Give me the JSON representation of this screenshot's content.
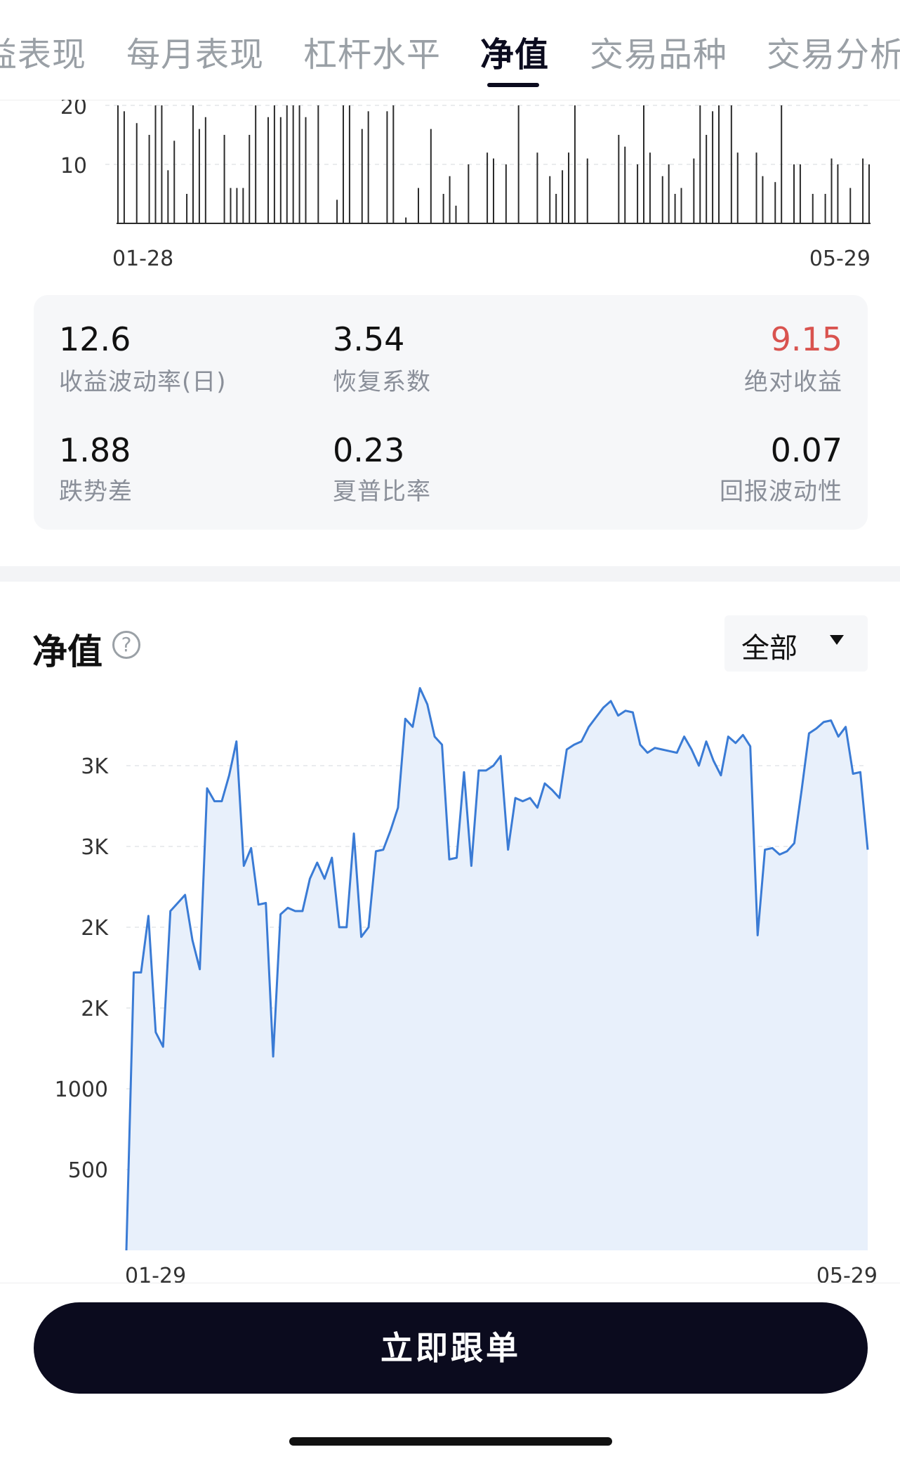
{
  "tabs": [
    {
      "label": "益表现",
      "active": false
    },
    {
      "label": "每月表现",
      "active": false
    },
    {
      "label": "杠杆水平",
      "active": false
    },
    {
      "label": "净值",
      "active": true
    },
    {
      "label": "交易品种",
      "active": false
    },
    {
      "label": "交易分析",
      "active": false
    }
  ],
  "stats": [
    {
      "value": "12.6",
      "label": "收益波动率(日)"
    },
    {
      "value": "3.54",
      "label": "恢复系数"
    },
    {
      "value": "9.15",
      "label": "绝对收益",
      "color": "#d9534f"
    },
    {
      "value": "1.88",
      "label": "跌势差"
    },
    {
      "value": "0.23",
      "label": "夏普比率"
    },
    {
      "value": "0.07",
      "label": "回报波动性"
    }
  ],
  "section": {
    "title": "净值",
    "help_icon": "question-circle-icon"
  },
  "range_select": {
    "value": "全部",
    "icon": "caret-down-icon"
  },
  "follow_button": {
    "label": "立即跟单"
  },
  "colors": {
    "accent": "#3a7bd5",
    "area": "#e8f0fb",
    "dark": "#0b0b1e",
    "positive_red": "#d9534f"
  },
  "chart_data": [
    {
      "type": "bar",
      "ytick_labels": [
        "20",
        "10"
      ],
      "y_ticks": [
        20,
        10
      ],
      "ylim": [
        0,
        20
      ],
      "xtick_labels": [
        "01-28",
        "05-29"
      ],
      "values": [
        20,
        19,
        0,
        17,
        0,
        15,
        20,
        20,
        9,
        14,
        0,
        5,
        20,
        16,
        18,
        0,
        0,
        15,
        6,
        6,
        6,
        15,
        20,
        0,
        18,
        20,
        18,
        20,
        20,
        20,
        18,
        0,
        20,
        0,
        0,
        4,
        20,
        20,
        0,
        16,
        19,
        0,
        0,
        19,
        20,
        0,
        1,
        0,
        6,
        0,
        16,
        0,
        5,
        8,
        3,
        0,
        10,
        0,
        0,
        12,
        11,
        0,
        10,
        0,
        20,
        0,
        0,
        12,
        0,
        8,
        5,
        9,
        12,
        20,
        0,
        11,
        0,
        0,
        0,
        0,
        15,
        13,
        0,
        10,
        20,
        12,
        0,
        8,
        10,
        5,
        6,
        0,
        11,
        20,
        15,
        19,
        20,
        0,
        20,
        12,
        0,
        0,
        12,
        8,
        0,
        7,
        20,
        0,
        10,
        10,
        0,
        5,
        0,
        5,
        11,
        10,
        0,
        6,
        0,
        11,
        10
      ],
      "grid": true
    },
    {
      "type": "area",
      "ytick_labels": [
        "3K",
        "3K",
        "2K",
        "2K",
        "1000",
        "500"
      ],
      "y_ticks": [
        3000,
        2500,
        2000,
        1500,
        1000,
        500
      ],
      "ylim": [
        0,
        3500
      ],
      "xtick_labels": [
        "01-29",
        "05-29"
      ],
      "values": [
        0,
        1720,
        1720,
        2070,
        1350,
        1260,
        2100,
        2150,
        2200,
        1920,
        1740,
        2860,
        2780,
        2780,
        2940,
        3150,
        2380,
        2490,
        2140,
        2150,
        1200,
        2080,
        2120,
        2100,
        2100,
        2300,
        2400,
        2300,
        2430,
        2000,
        2000,
        2580,
        1940,
        2000,
        2470,
        2480,
        2600,
        2740,
        3290,
        3240,
        3480,
        3380,
        3180,
        3130,
        2420,
        2430,
        2960,
        2380,
        2970,
        2970,
        3000,
        3060,
        2480,
        2800,
        2780,
        2800,
        2740,
        2890,
        2850,
        2800,
        3100,
        3130,
        3150,
        3240,
        3300,
        3360,
        3400,
        3310,
        3340,
        3330,
        3130,
        3080,
        3110,
        3100,
        3090,
        3080,
        3180,
        3100,
        3000,
        3150,
        3030,
        2940,
        3180,
        3140,
        3190,
        3120,
        1950,
        2480,
        2490,
        2450,
        2470,
        2520,
        2850,
        3200,
        3230,
        3270,
        3280,
        3180,
        3240,
        2950,
        2960,
        2480
      ],
      "grid": true
    }
  ]
}
